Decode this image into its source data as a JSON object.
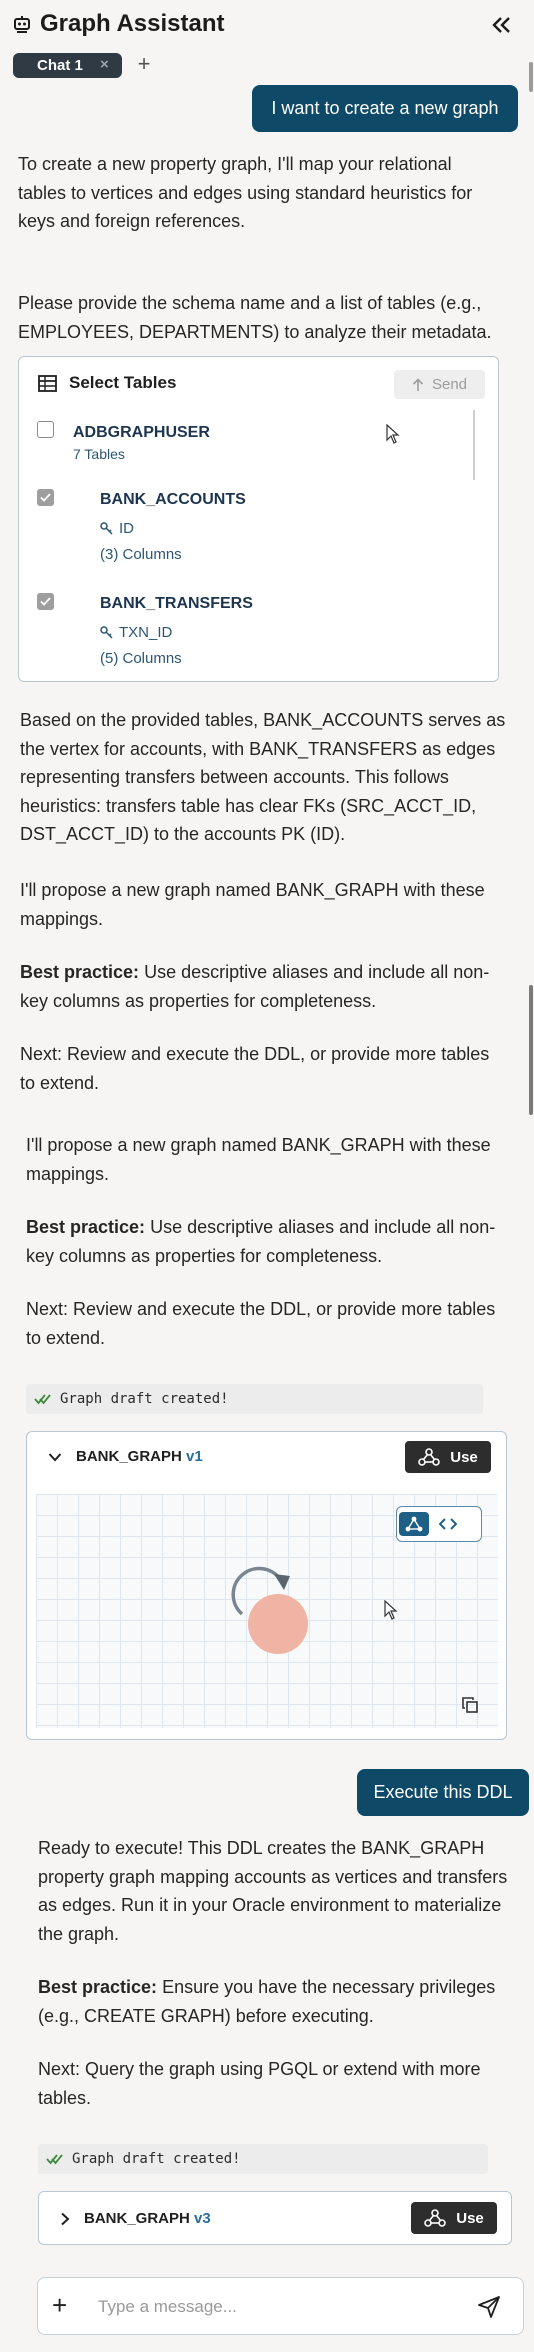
{
  "header": {
    "title": "Graph Assistant",
    "tabs": [
      {
        "label": "Chat 1"
      }
    ],
    "add_tab": "+"
  },
  "messages": {
    "user1": "I want to create a new graph",
    "assistant1": {
      "p1": "To create a new property graph, I'll map your relational tables to vertices and edges using standard heuristics for keys and foreign references.",
      "p2": "Please provide the schema name and a list of tables (e.g., EMPLOYEES, DEPARTMENTS) to analyze their metadata."
    },
    "select_tables": {
      "title": "Select Tables",
      "send_label": "Send",
      "schema": {
        "name": "ADBGRAPHUSER",
        "sub": "7 Tables",
        "checked": false
      },
      "tables": [
        {
          "name": "BANK_ACCOUNTS",
          "key": "ID",
          "columns": "(3) Columns",
          "checked": true
        },
        {
          "name": "BANK_TRANSFERS",
          "key": "TXN_ID",
          "columns": "(5) Columns",
          "checked": true
        }
      ]
    },
    "assistant2": {
      "p1": "Based on the provided tables, BANK_ACCOUNTS serves as the vertex for accounts, with BANK_TRANSFERS as edges representing transfers between accounts. This follows heuristics: transfers table has clear FKs (SRC_ACCT_ID, DST_ACCT_ID) to the accounts PK (ID).",
      "p2": "I'll propose a new graph named BANK_GRAPH with these mappings.",
      "p3_bold": "Best practice:",
      "p3_rest": " Use descriptive aliases and include all non-key columns as properties for completeness.",
      "p4": "Next: Review and execute the DDL, or provide more tables to extend."
    },
    "assistant3": {
      "p1": "I'll propose a new graph named BANK_GRAPH with these mappings.",
      "p2_bold": "Best practice:",
      "p2_rest": " Use descriptive aliases and include all non-key columns as properties for completeness.",
      "p3": "Next: Review and execute the DDL, or provide more tables to extend.",
      "status": "Graph draft created!",
      "graph": {
        "name": "BANK_GRAPH",
        "version": "v1",
        "use_label": "Use",
        "expanded": true
      }
    },
    "user2": "Execute this DDL",
    "assistant4": {
      "p1": "Ready to execute! This DDL creates the BANK_GRAPH property graph mapping accounts as vertices and transfers as edges. Run it in your Oracle environment to materialize the graph.",
      "p2_bold": "Best practice:",
      "p2_rest": " Ensure you have the necessary privileges (e.g., CREATE GRAPH) before executing.",
      "p3": "Next: Query the graph using PGQL or extend with more tables.",
      "status": "Graph draft created!",
      "graph": {
        "name": "BANK_GRAPH",
        "version": "v3",
        "use_label": "Use",
        "expanded": false
      }
    }
  },
  "composer": {
    "placeholder": "Type a message...",
    "add": "+"
  },
  "colors": {
    "accent": "#0e4a68",
    "node": "#efb4a4",
    "use_button": "#2d2d2d"
  }
}
